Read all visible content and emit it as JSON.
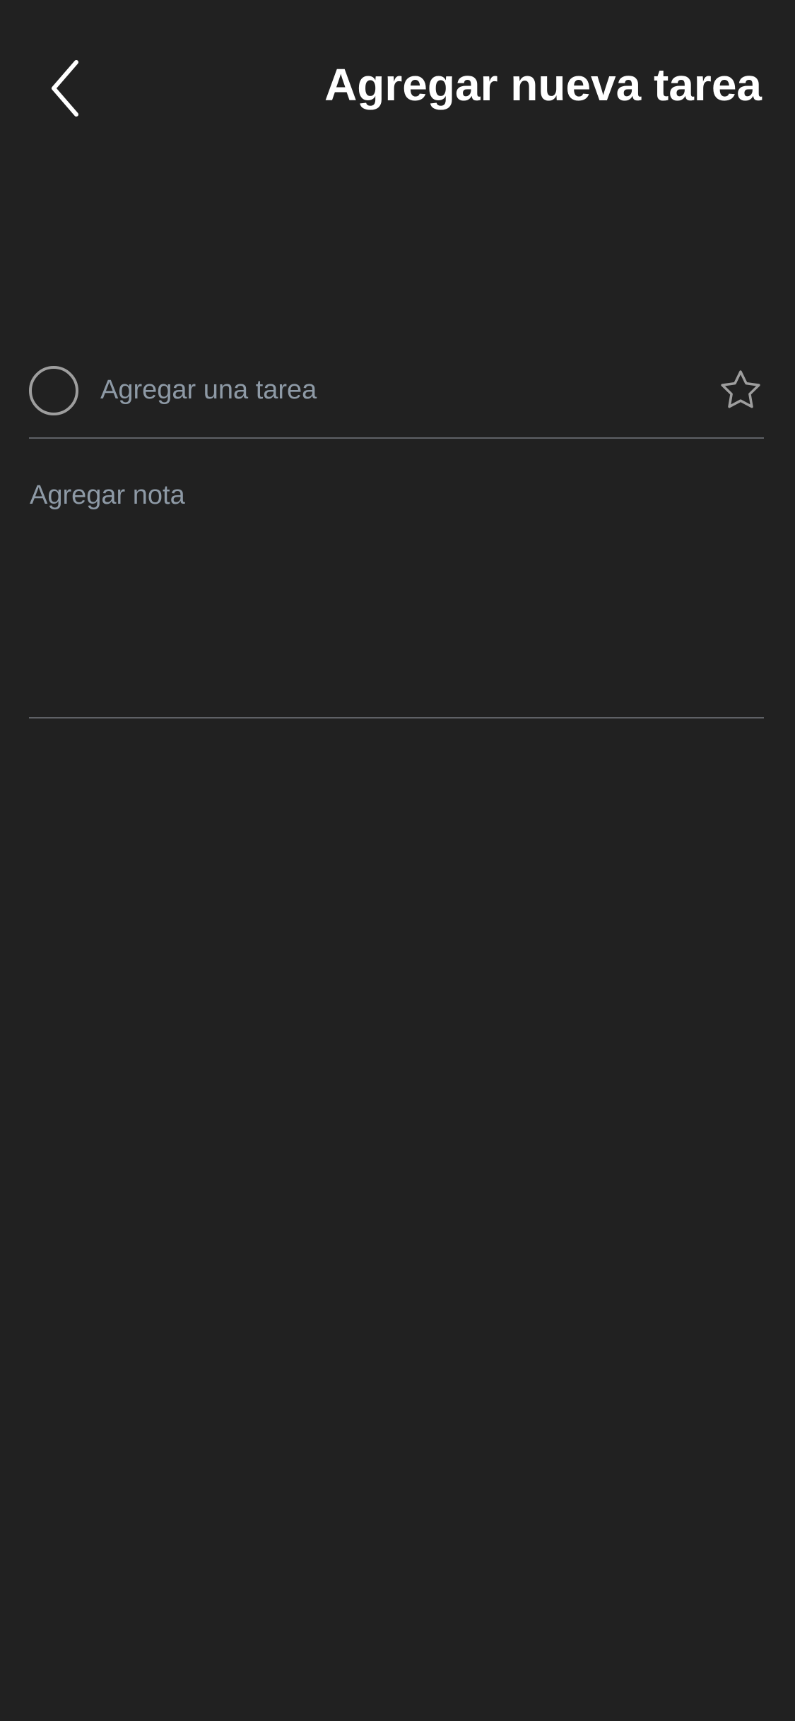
{
  "header": {
    "back_icon": "chevron-left-icon",
    "title": "Agregar nueva tarea"
  },
  "task": {
    "complete_icon": "circle-outline-icon",
    "placeholder": "Agregar una tarea",
    "value": "",
    "star_icon": "star-outline-icon"
  },
  "note": {
    "placeholder": "Agregar nota",
    "value": ""
  },
  "colors": {
    "background": "#212121",
    "title": "#ffffff",
    "placeholder": "#8e9aa6",
    "divider": "#5f6166",
    "icon": "#9e9e9e"
  }
}
